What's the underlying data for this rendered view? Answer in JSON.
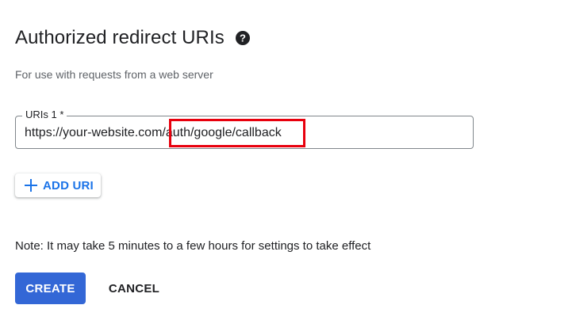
{
  "section": {
    "title": "Authorized redirect URIs",
    "help_icon": "help-circle-icon",
    "subtitle": "For use with requests from a web server"
  },
  "uri_field": {
    "label": "URIs 1 *",
    "value": "https://your-website.com/auth/google/callback",
    "highlight_color": "#e8000d"
  },
  "add_uri_button": {
    "icon": "plus-icon",
    "label": "ADD URI",
    "color": "#1a73e8"
  },
  "note": "Note: It may take 5 minutes to a few hours for settings to take effect",
  "actions": {
    "create_label": "CREATE",
    "create_color": "#3367d6",
    "cancel_label": "CANCEL"
  }
}
